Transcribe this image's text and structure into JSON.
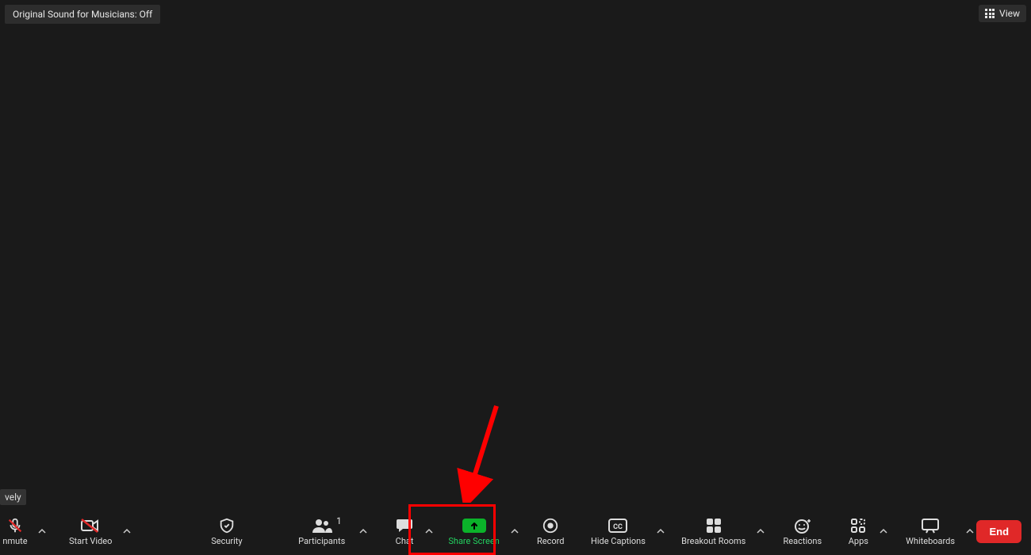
{
  "top_left_pill": "Original Sound for Musicians: Off",
  "top_right_view": "View",
  "name_tag": "vely",
  "toolbar": {
    "mute": {
      "label": "nmute"
    },
    "video": {
      "label": "Start Video"
    },
    "security": {
      "label": "Security"
    },
    "participants": {
      "label": "Participants",
      "count": "1"
    },
    "chat": {
      "label": "Chat"
    },
    "share": {
      "label": "Share Screen"
    },
    "record": {
      "label": "Record"
    },
    "captions": {
      "label": "Hide Captions"
    },
    "breakout": {
      "label": "Breakout Rooms"
    },
    "reactions": {
      "label": "Reactions"
    },
    "apps": {
      "label": "Apps"
    },
    "whiteboards": {
      "label": "Whiteboards"
    },
    "end": {
      "label": "End"
    }
  }
}
